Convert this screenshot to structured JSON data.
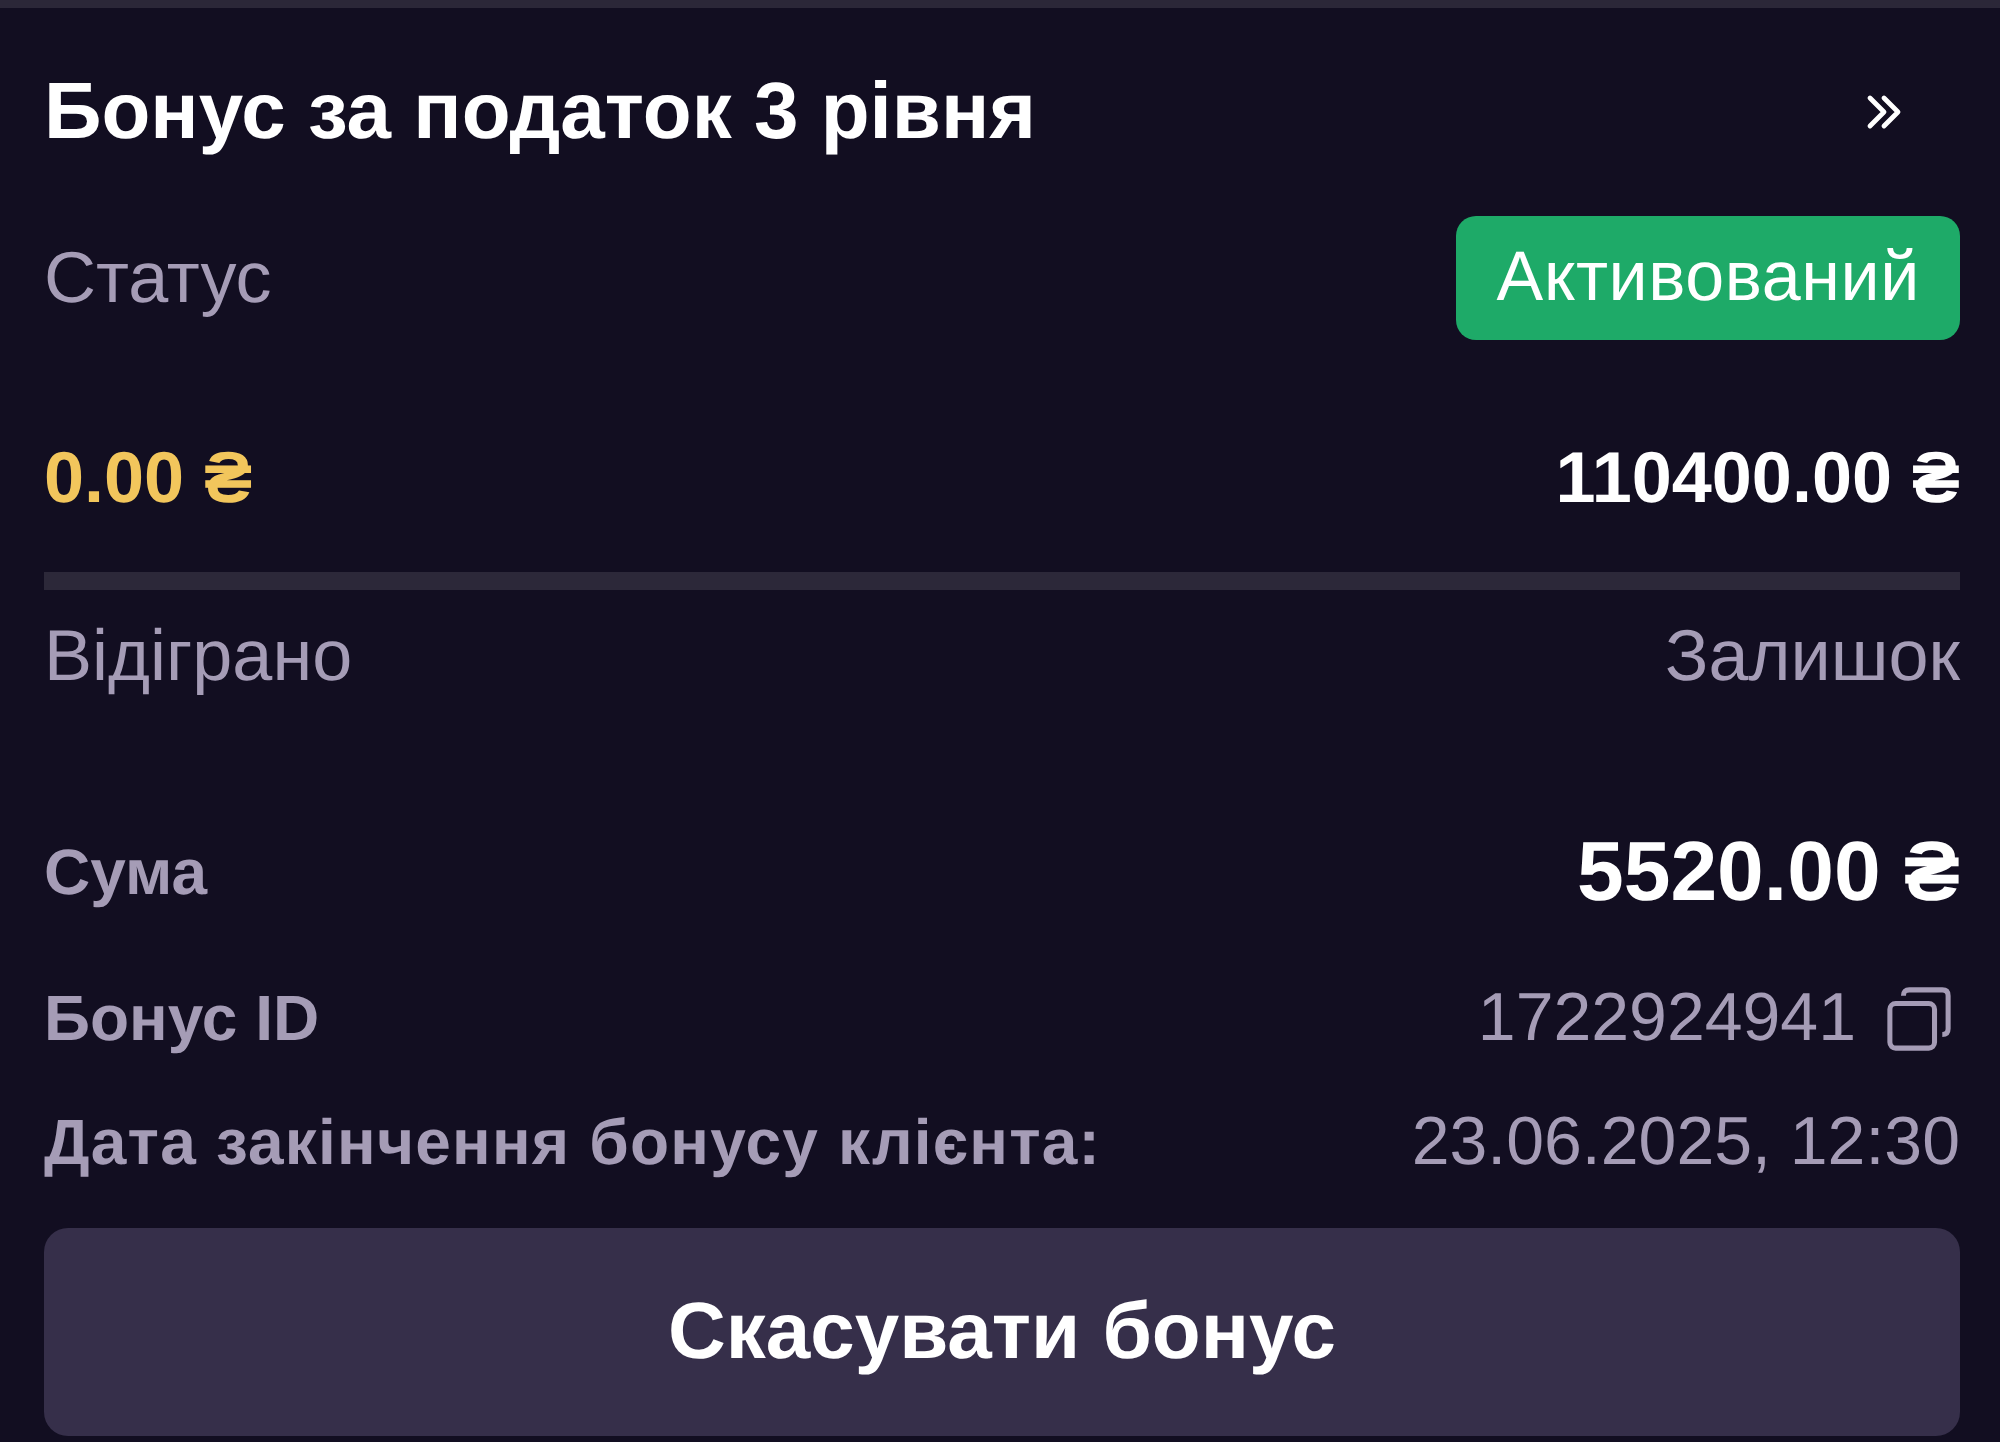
{
  "header": {
    "title": "Бонус за податок 3 рівня"
  },
  "status": {
    "label": "Статус",
    "value": "Активований",
    "kind": "active"
  },
  "progress": {
    "wagered": "0.00 ₴",
    "remaining": "110400.00 ₴",
    "wagered_label": "Відіграно",
    "remaining_label": "Залишок"
  },
  "details": [
    {
      "label": "Сума",
      "value": "5520.00 ₴",
      "kind": "amount"
    },
    {
      "label": "Бонус ID",
      "value": "1722924941",
      "kind": "copyable"
    },
    {
      "label": "Дата закінчення бонусу клієнта:",
      "value": "23.06.2025, 12:30",
      "kind": "plain"
    }
  ],
  "button": {
    "label": "Скасувати бонус"
  }
}
